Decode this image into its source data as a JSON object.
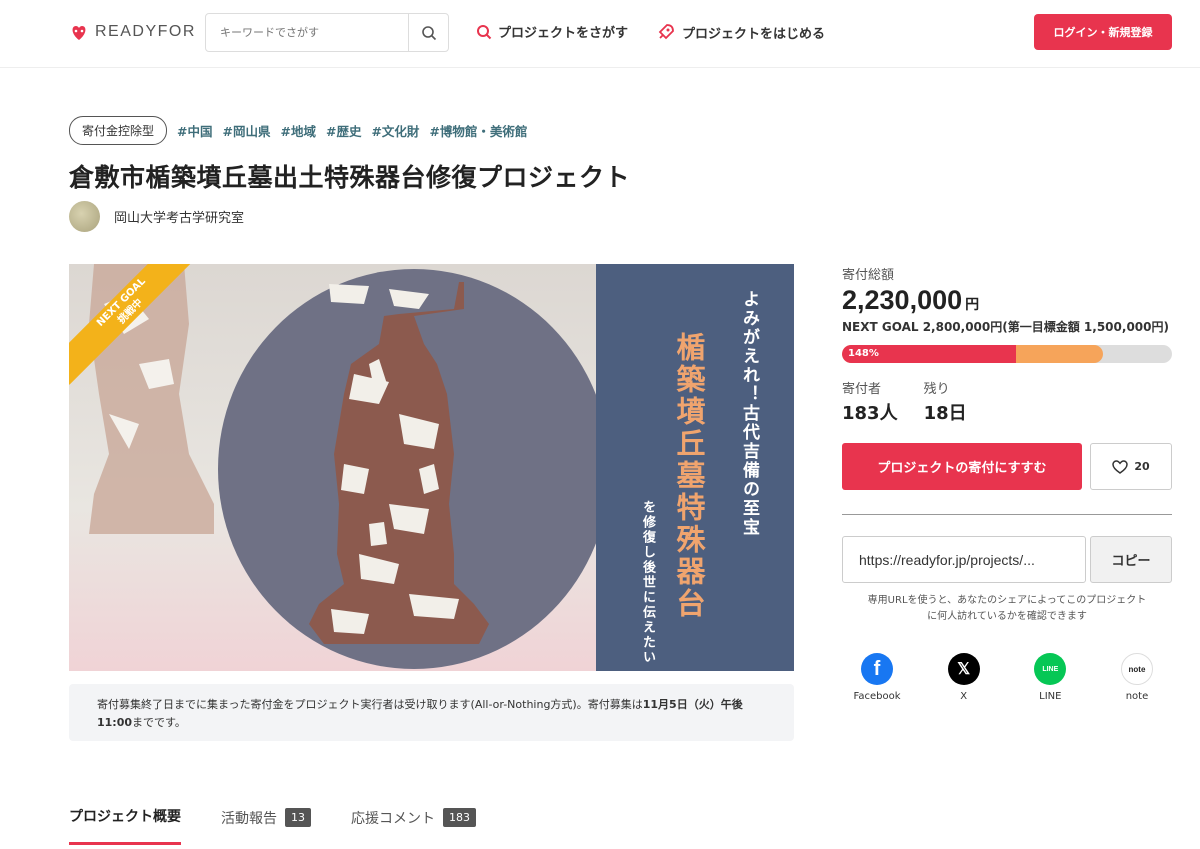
{
  "header": {
    "logo_text": "READYFOR",
    "search_placeholder": "キーワードでさがす",
    "nav_find": "プロジェクトをさがす",
    "nav_start": "プロジェクトをはじめる",
    "login_label": "ログイン・新規登録"
  },
  "project": {
    "type_tag": "寄付金控除型",
    "tags": [
      "#中国",
      "#岡山県",
      "#地域",
      "#歴史",
      "#文化財",
      "#博物館・美術館"
    ],
    "title": "倉敷市楯築墳丘墓出土特殊器台修復プロジェクト",
    "owner": "岡山大学考古学研究室"
  },
  "hero": {
    "ribbon_line1": "NEXT GOAL",
    "ribbon_line2": "挑戦中",
    "catch": "よみがえれ！古代吉備の至宝",
    "main": "楯築墳丘墓特殊器台",
    "sub": "を修復し後世に伝えたい"
  },
  "notice": {
    "text_pre": "寄付募集終了日までに集まった寄付金をプロジェクト実行者は受け取ります(All-or-Nothing方式)。寄付募集は",
    "deadline": "11月5日（火）午後11:00",
    "text_post": "までです。"
  },
  "tabs": [
    {
      "label": "プロジェクト概要"
    },
    {
      "label": "活動報告",
      "count": "13"
    },
    {
      "label": "応援コメント",
      "count": "183"
    }
  ],
  "funding": {
    "total_label": "寄付総額",
    "amount": "2,230,000",
    "unit": "円",
    "next_goal": "NEXT GOAL 2,800,000円(第一目標金額 1,500,000円)",
    "percent_label": "148%",
    "progress_fraction": 0.526,
    "next_goal_fraction": 0.79,
    "donors_label": "寄付者",
    "donors": "183人",
    "remaining_label": "残り",
    "remaining": "18日",
    "cta": "プロジェクトの寄付にすすむ",
    "favorites": "20"
  },
  "share": {
    "url": "https://readyfor.jp/projects/...",
    "copy": "コピー",
    "note": "専用URLを使うと、あなたのシェアによってこのプロジェクトに何人訪れているかを確認できます",
    "items": [
      {
        "label": "Facebook",
        "color": "#1877f2"
      },
      {
        "label": "X",
        "color": "#000000"
      },
      {
        "label": "LINE",
        "color": "#06c755"
      },
      {
        "label": "note",
        "color": "#ffffff"
      }
    ]
  },
  "colors": {
    "accent": "#e8344e",
    "tag": "#3f6e7a",
    "ribbon": "#f3b21a",
    "panel": "#4d5f7f",
    "hero_title": "#f0a46e"
  }
}
